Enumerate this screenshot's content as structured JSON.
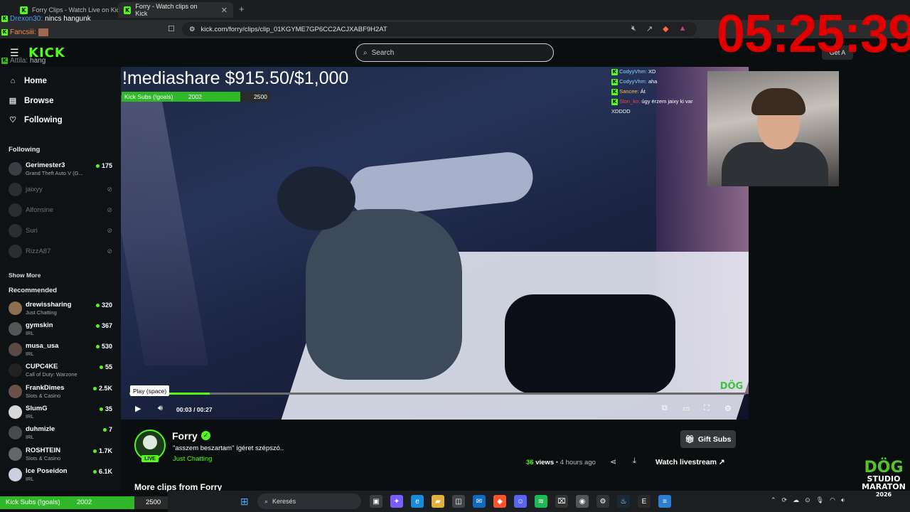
{
  "browser": {
    "tabs": [
      {
        "label": "Forry Clips - Watch Live on Kick"
      },
      {
        "label": "Forry - Watch clips on Kick"
      }
    ],
    "url": "kick.com/forry/clips/clip_01KGYME7GP6CC2ACJXABF9H2AT"
  },
  "header": {
    "logo": "KICK",
    "search_placeholder": "Search",
    "get_app": "Get A"
  },
  "sidebar": {
    "nav": [
      {
        "label": "Home",
        "icon": "home-icon"
      },
      {
        "label": "Browse",
        "icon": "browse-icon"
      },
      {
        "label": "Following",
        "icon": "heart-icon"
      }
    ],
    "following_title": "Following",
    "following": [
      {
        "name": "Gerimester3",
        "category": "Grand Theft Auto V (G...",
        "viewers": "175",
        "live": true
      },
      {
        "name": "jaixyy",
        "live": false
      },
      {
        "name": "Alfonsine",
        "live": false
      },
      {
        "name": "Suri",
        "live": false
      },
      {
        "name": "RizzA87",
        "live": false
      }
    ],
    "show_more": "Show More",
    "recommended_title": "Recommended",
    "recommended": [
      {
        "name": "drewissharing",
        "category": "Just Chatting",
        "viewers": "320"
      },
      {
        "name": "gymskin",
        "category": "IRL",
        "viewers": "367"
      },
      {
        "name": "musa_usa",
        "category": "IRL",
        "viewers": "530"
      },
      {
        "name": "CUPC4KE",
        "category": "Call of Duty: Warzone",
        "viewers": "55"
      },
      {
        "name": "FrankDimes",
        "category": "Slots & Casino",
        "viewers": "2.5K"
      },
      {
        "name": "SlumG",
        "category": "IRL",
        "viewers": "35"
      },
      {
        "name": "duhmizle",
        "category": "IRL",
        "viewers": "7"
      },
      {
        "name": "ROSHTEIN",
        "category": "Slots & Casino",
        "viewers": "1.7K"
      },
      {
        "name": "Ice Poseidon",
        "category": "IRL",
        "viewers": "6.1K"
      }
    ]
  },
  "overlay": {
    "mediashare": "!mediashare $915.50/$1,000",
    "goal": {
      "label": "Kick Subs (!goals)",
      "current": "2002",
      "target": "2500",
      "progress": 0.8
    },
    "timer": "05:25:39",
    "stream_chat": [
      {
        "user": "CodyyVhm:",
        "msg": "XD"
      },
      {
        "user": "CodyyVhm:",
        "msg": "aha"
      },
      {
        "user": "Sancee:",
        "msg": "Át"
      },
      {
        "user": "Slon_ko:",
        "msg": "úgy érzem jaixy ki var XDDDD"
      }
    ],
    "top_chat": [
      {
        "user": "Drexon30:",
        "msg": "nincs hangunk"
      },
      {
        "user": "Fancsiii:",
        "msg": ""
      },
      {
        "user": "Attila:",
        "msg": "hang"
      }
    ],
    "watermark": "DÖG",
    "watermark_sub": "STUDIO"
  },
  "player": {
    "tooltip": "Play (space)",
    "current_time": "00:03",
    "duration": "00:27",
    "progress": 0.13
  },
  "clip": {
    "streamer": "Forry",
    "live_label": "LIVE",
    "title": "\"asszem beszartam\" ígéret szépszó..",
    "category": "Just Chatting",
    "gift_label": "Gift Subs",
    "views_count": "36",
    "views_label": "views",
    "age": "4 hours ago",
    "watch_label": "Watch livestream",
    "more_clips": "More clips from Forry"
  },
  "taskbar": {
    "search_placeholder": "Keresés",
    "stream_logo_line1": "DÖG",
    "stream_logo_line2": "STUDIO",
    "stream_logo_line3": "MARATON",
    "stream_logo_year": "2026"
  }
}
